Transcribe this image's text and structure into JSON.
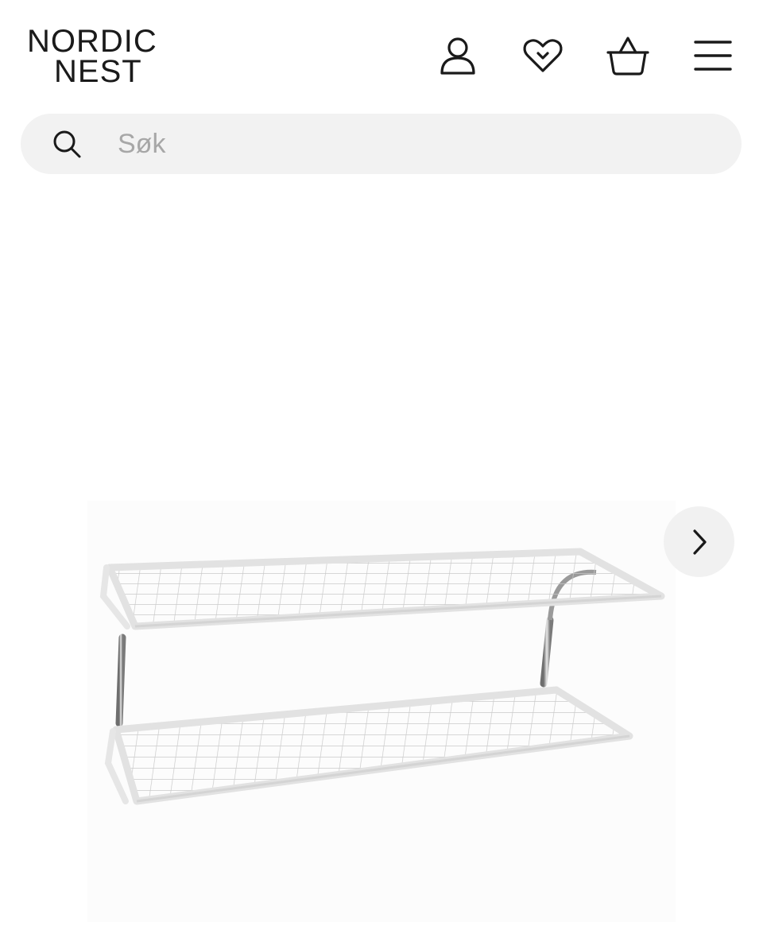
{
  "brand": {
    "logo_line1": "NORDIC",
    "logo_line2": "NEST"
  },
  "header": {
    "icons": [
      {
        "name": "account-icon"
      },
      {
        "name": "heart-icon"
      },
      {
        "name": "basket-icon"
      },
      {
        "name": "menu-icon"
      }
    ]
  },
  "search": {
    "placeholder": "Søk",
    "value": ""
  },
  "gallery": {
    "next_icon": "chevron-right-icon"
  },
  "colors": {
    "text": "#1a1a1a",
    "search_bg": "#f2f2f2",
    "placeholder": "#a7a7a7",
    "nav_button_bg": "#f1f1f1"
  }
}
